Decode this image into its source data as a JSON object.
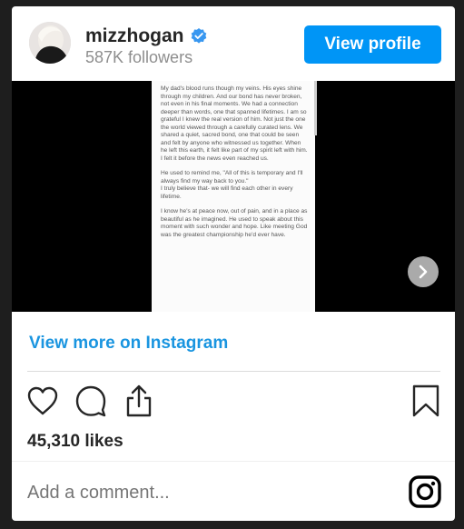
{
  "profile": {
    "username": "mizzhogan",
    "followers": "587K followers",
    "view_profile_label": "View profile"
  },
  "post_text": [
    "My dad's blood runs though my veins. His eyes shine through my children. And our bond has never broken, not even in his final moments. We had a connection deeper than words, one that spanned lifetimes. I am so grateful I knew the real version of him. Not just the one the world viewed through a carefully curated lens. We shared a quiet, sacred bond, one that could be seen and felt by anyone who witnessed us together. When he left this earth, it felt like part of my spirit left with him. I felt it before the news even reached us.",
    "He used to remind me, \"All of this is temporary and I'll always find my way back to you.\"\nI truly believe that- we will find each other in every lifetime.",
    "I know he's at peace now, out of pain, and in a place as beautiful as he imagined. He used to speak about this moment with such wonder and hope.  Like meeting God was the greatest championship he'd ever have."
  ],
  "view_more_label": "View more on Instagram",
  "likes": "45,310 likes",
  "comment_placeholder": "Add a comment...",
  "icons": {
    "verified": "verified-badge-icon",
    "next": "chevron-right-icon",
    "like": "heart-icon",
    "comment": "comment-bubble-icon",
    "share": "share-icon",
    "save": "bookmark-icon",
    "logo": "instagram-logo-icon"
  },
  "colors": {
    "accent": "#0095f6",
    "link": "#1a95e0",
    "page_background": "#1e1e1e"
  }
}
